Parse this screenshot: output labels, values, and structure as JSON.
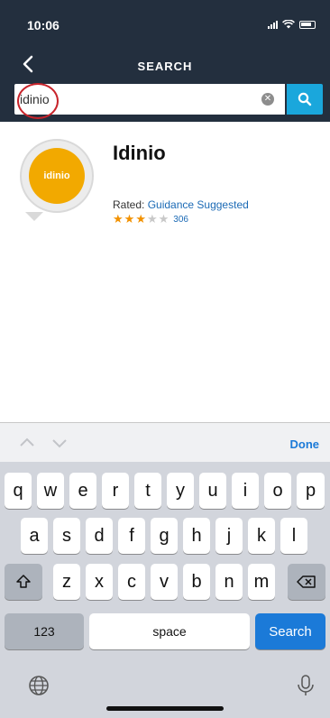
{
  "status": {
    "time": "10:06"
  },
  "header": {
    "title": "SEARCH"
  },
  "search": {
    "value": "idinio",
    "placeholder": ""
  },
  "result": {
    "name": "Idinio",
    "icon_text": "idinio",
    "rated_label": "Rated:",
    "rated_value": "Guidance Suggested",
    "rating": 3,
    "max_rating": 5,
    "review_count": "306"
  },
  "keyboard": {
    "done_label": "Done",
    "row1": [
      "q",
      "w",
      "e",
      "r",
      "t",
      "y",
      "u",
      "i",
      "o",
      "p"
    ],
    "row2": [
      "a",
      "s",
      "d",
      "f",
      "g",
      "h",
      "j",
      "k",
      "l"
    ],
    "row3": [
      "z",
      "x",
      "c",
      "v",
      "b",
      "n",
      "m"
    ],
    "numbers_label": "123",
    "space_label": "space",
    "search_label": "Search"
  },
  "colors": {
    "header_bg": "#232f3e",
    "search_button": "#1aa7dc",
    "accent_blue": "#1b7ad8",
    "star_color": "#f29100",
    "icon_bg": "#f2a900"
  }
}
